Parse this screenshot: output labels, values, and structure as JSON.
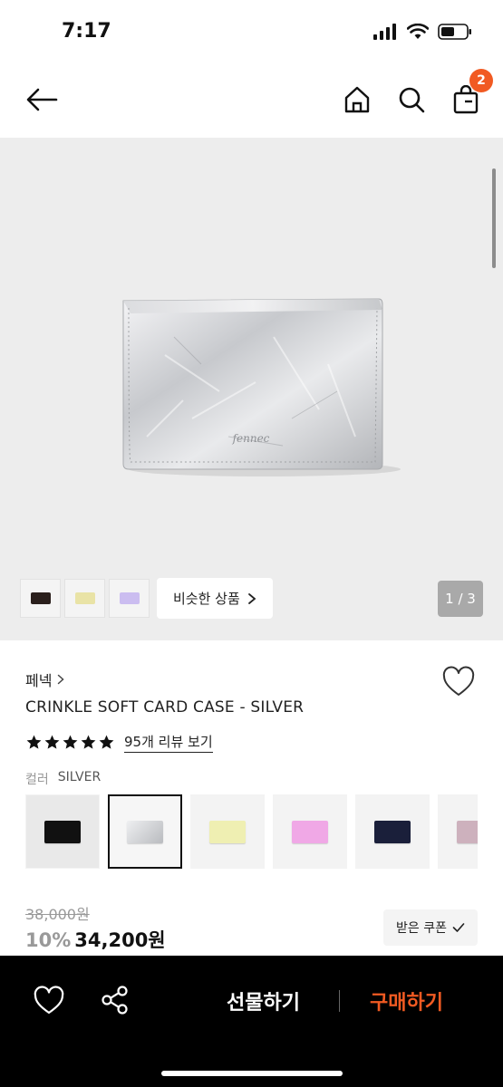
{
  "status": {
    "time": "7:17",
    "icons": [
      "cellular-signal-icon",
      "wifi-icon",
      "battery-icon"
    ]
  },
  "nav": {
    "icons": [
      "back-arrow-icon",
      "home-icon",
      "search-icon",
      "shopping-bag-icon"
    ],
    "cart_count": "2"
  },
  "gallery": {
    "thumbnails": [
      {
        "color": "#2a1f1c",
        "icon": "wallet-thumbnail-black"
      },
      {
        "color": "#e9e3a6",
        "icon": "wallet-thumbnail-yellow"
      },
      {
        "color": "#cbbdf0",
        "icon": "wallet-thumbnail-lavender"
      }
    ],
    "similar_label": "비슷한 상품",
    "page_counter": "1 / 3"
  },
  "product": {
    "brand": "페넥",
    "name": "CRINKLE SOFT CARD CASE - SILVER",
    "rating": 5,
    "review_label": "95개 리뷰 보기",
    "color_label": "컬러",
    "color_value": "SILVER",
    "swatches": [
      {
        "color": "#111111"
      },
      {
        "color": "#d4d6d9"
      },
      {
        "color": "#efefb2"
      },
      {
        "color": "#f0a8e6"
      },
      {
        "color": "#1a1f3a"
      },
      {
        "color": "#cdb1bd"
      }
    ],
    "original_price": "38,000원",
    "discount": "10%",
    "sale_price": "34,200원",
    "coupon_label": "받은 쿠폰"
  },
  "bottom_bar": {
    "gift_label": "선물하기",
    "buy_label": "구매하기"
  },
  "colors": {
    "accent": "#f15a22",
    "hero_background": "#ededed",
    "bottom_bar": "#000000"
  }
}
